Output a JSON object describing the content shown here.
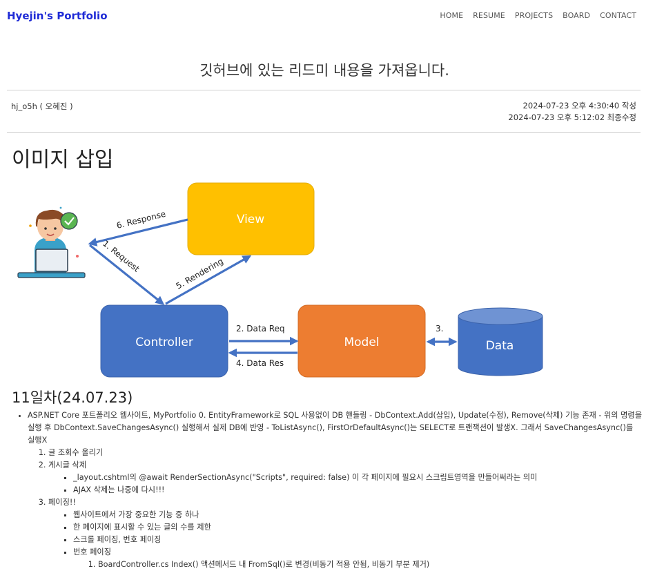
{
  "header": {
    "brand": "Hyejin's Portfolio",
    "nav": [
      "HOME",
      "RESUME",
      "PROJECTS",
      "BOARD",
      "CONTACT"
    ]
  },
  "post": {
    "title": "깃허브에 있는 리드미 내용을 가져옵니다.",
    "author": "hj_o5h ( 오혜진 )",
    "created": "2024-07-23 오후 4:30:40 작성",
    "modified": "2024-07-23 오후 5:12:02 최종수정"
  },
  "section_image": {
    "heading": "이미지 삽입"
  },
  "diagram": {
    "view_label": "View",
    "controller_label": "Controller",
    "model_label": "Model",
    "data_label": "Data",
    "arrow_response": "6. Response",
    "arrow_request": "1. Request",
    "arrow_rendering": "5. Rendering",
    "arrow_data_req": "2. Data Req",
    "arrow_data_res": "4. Data Res",
    "arrow_three": "3.",
    "colors": {
      "view": "#FFC000",
      "controller": "#4472C4",
      "model": "#ED7D31",
      "data": "#4472C4",
      "arrow": "#4472C4"
    }
  },
  "section_day": {
    "heading": "11일차(24.07.23)",
    "bullet": "ASP.NET Core 포트폴리오 웹사이트, MyPortfolio 0. EntityFramework로 SQL 사용없이 DB 핸들링 - DbContext.Add(삽입), Update(수정), Remove(삭제) 기능 존재 - 위의 명령을 실행 후 DbContext.SaveChangesAsync() 실행해서 실제 DB에 반영 - ToListAsync(), FirstOrDefaultAsync()는 SELECT로 트랜잭션이 발생X. 그래서 SaveChangesAsync()를 실행X",
    "items": [
      {
        "label": "글 조회수 올리기"
      },
      {
        "label": "게시글 삭제",
        "sub": [
          "_layout.cshtml의 @await RenderSectionAsync(\"Scripts\", required: false) 이 각 페이지에 필요시 스크립트영역을 만들어써라는 의미",
          "AJAX 삭제는 나중에 다시!!!"
        ]
      },
      {
        "label": "페이징!!",
        "sub": [
          "웹사이트에서 가장 중요한 기능 중 하나",
          "한 페이지에 표시할 수 있는 글의 수를 제한",
          "스크롤 페이징, 번호 페이징",
          "번호 페이징"
        ],
        "subsub": [
          "BoardController.cs Index() 액션메서드 내 FromSql()로 변경(비동기 적용 안됨, 비동기 부분 제거)"
        ]
      }
    ]
  }
}
